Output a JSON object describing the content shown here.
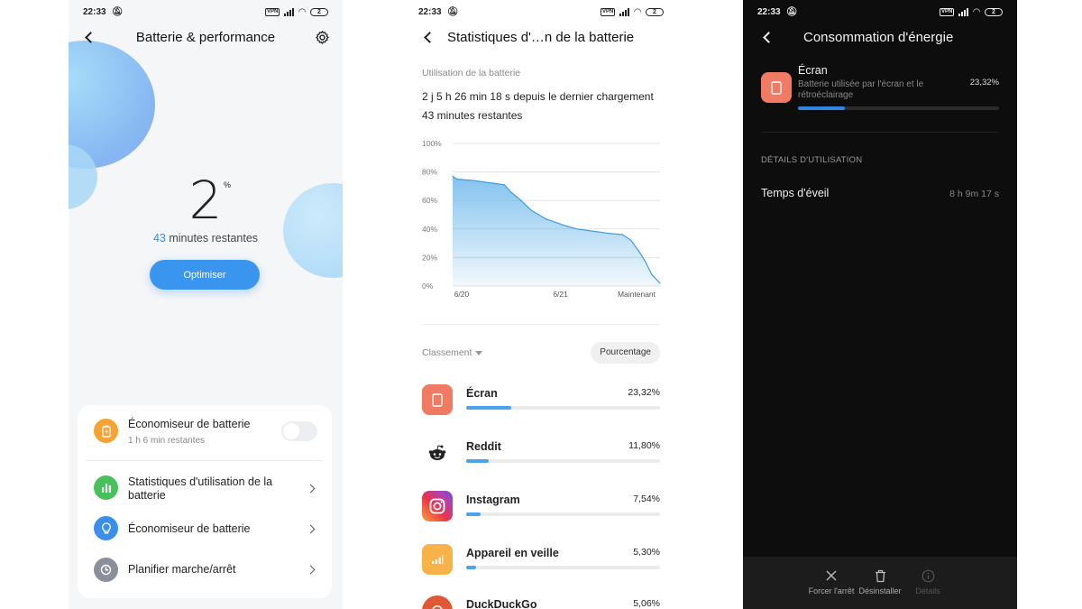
{
  "status_bar": {
    "time": "22:33",
    "vpn": "VPN",
    "battery": "2"
  },
  "screen1": {
    "title": "Batterie & performance",
    "battery_value": "2",
    "percent_sign": "%",
    "remaining_minutes": "43",
    "remaining_label": "minutes restantes",
    "optimize_button": "Optimiser",
    "items": [
      {
        "label": "Économiseur de batterie",
        "sub": "1 h 6 min restantes",
        "control": "toggle",
        "icon": "battery-saver-icon",
        "color": "#f6a234"
      },
      {
        "label": "Statistiques d'utilisation de la batterie",
        "control": "chevron",
        "icon": "bar-chart-icon",
        "color": "#47c15b"
      },
      {
        "label": "Économiseur de batterie",
        "control": "chevron",
        "icon": "lightbulb-icon",
        "color": "#3b8fea"
      },
      {
        "label": "Planifier marche/arrêt",
        "control": "chevron",
        "icon": "clock-icon",
        "color": "#8a8f99"
      }
    ]
  },
  "screen2": {
    "title": "Statistiques d'…n de la batterie",
    "section_label": "Utilisation de la batterie",
    "since_charge": "2 j 5 h 26 min 18 s depuis le dernier chargement",
    "remaining": "43 minutes restantes",
    "sort_label": "Classement",
    "sort_button": "Pourcentage",
    "apps": [
      {
        "name": "Écran",
        "percent": "23,32%",
        "value": 23.32,
        "icon": "screen-icon"
      },
      {
        "name": "Reddit",
        "percent": "11,80%",
        "value": 11.8,
        "icon": "reddit-icon"
      },
      {
        "name": "Instagram",
        "percent": "7,54%",
        "value": 7.54,
        "icon": "instagram-icon"
      },
      {
        "name": "Appareil en veille",
        "percent": "5,30%",
        "value": 5.3,
        "icon": "standby-icon"
      },
      {
        "name": "DuckDuckGo",
        "percent": "5,06%",
        "value": 5.06,
        "icon": "duckduckgo-icon"
      }
    ]
  },
  "chart_data": {
    "type": "area",
    "x_ticks": [
      "6/20",
      "6/21",
      "Maintenant"
    ],
    "y_ticks": [
      "100%",
      "80%",
      "60%",
      "40%",
      "20%",
      "0%"
    ],
    "ylim": [
      0,
      100
    ],
    "x": [
      0,
      0.02,
      0.1,
      0.2,
      0.25,
      0.28,
      0.33,
      0.38,
      0.45,
      0.55,
      0.6,
      0.65,
      0.75,
      0.82,
      0.86,
      0.9,
      0.93,
      0.96,
      1.0
    ],
    "values": [
      77,
      75,
      74,
      72,
      71,
      66,
      60,
      53,
      47,
      42,
      40,
      39,
      37,
      36,
      32,
      24,
      17,
      8,
      2
    ],
    "grid": true,
    "color": "#5aaee8"
  },
  "screen3": {
    "title": "Consommation d'énergie",
    "app_name": "Écran",
    "app_desc": "Batterie utilisée par l'écran et le rétroéclairage",
    "app_percent": "23,32%",
    "app_value": 23.32,
    "section": "DÉTAILS D'UTILISATION",
    "wake_label": "Temps d'éveil",
    "wake_value": "8 h 9m 17 s",
    "actions": [
      {
        "label": "Forcer l'arrêt",
        "icon": "close-icon",
        "enabled": true
      },
      {
        "label": "Désinstaller",
        "icon": "trash-icon",
        "enabled": true
      },
      {
        "label": "Détails",
        "icon": "info-icon",
        "enabled": false
      }
    ]
  }
}
